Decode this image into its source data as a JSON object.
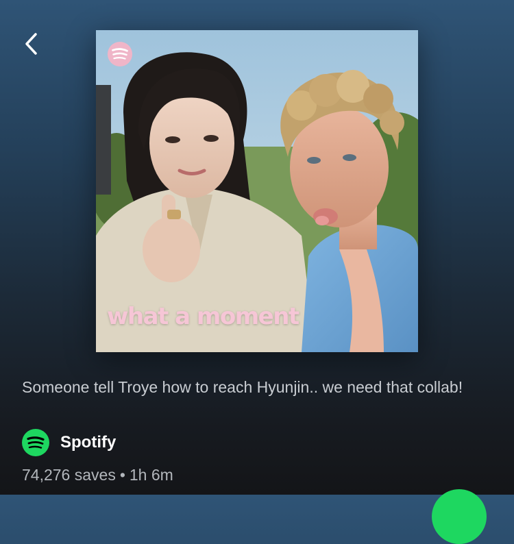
{
  "header": {
    "back_icon": "chevron-left-icon"
  },
  "cover": {
    "logo_icon": "spotify-logo-icon",
    "caption": "what a moment"
  },
  "playlist": {
    "description": "Someone tell Troye how to reach Hyunjin.. we need that collab!",
    "owner_name": "Spotify",
    "owner_icon": "spotify-logo-icon",
    "saves": "74,276 saves",
    "separator": "•",
    "duration": "1h 6m"
  },
  "colors": {
    "accent": "#1ed760",
    "caption": "#f6c6d6",
    "background_top": "#2f5476",
    "background_bottom": "#141518"
  }
}
